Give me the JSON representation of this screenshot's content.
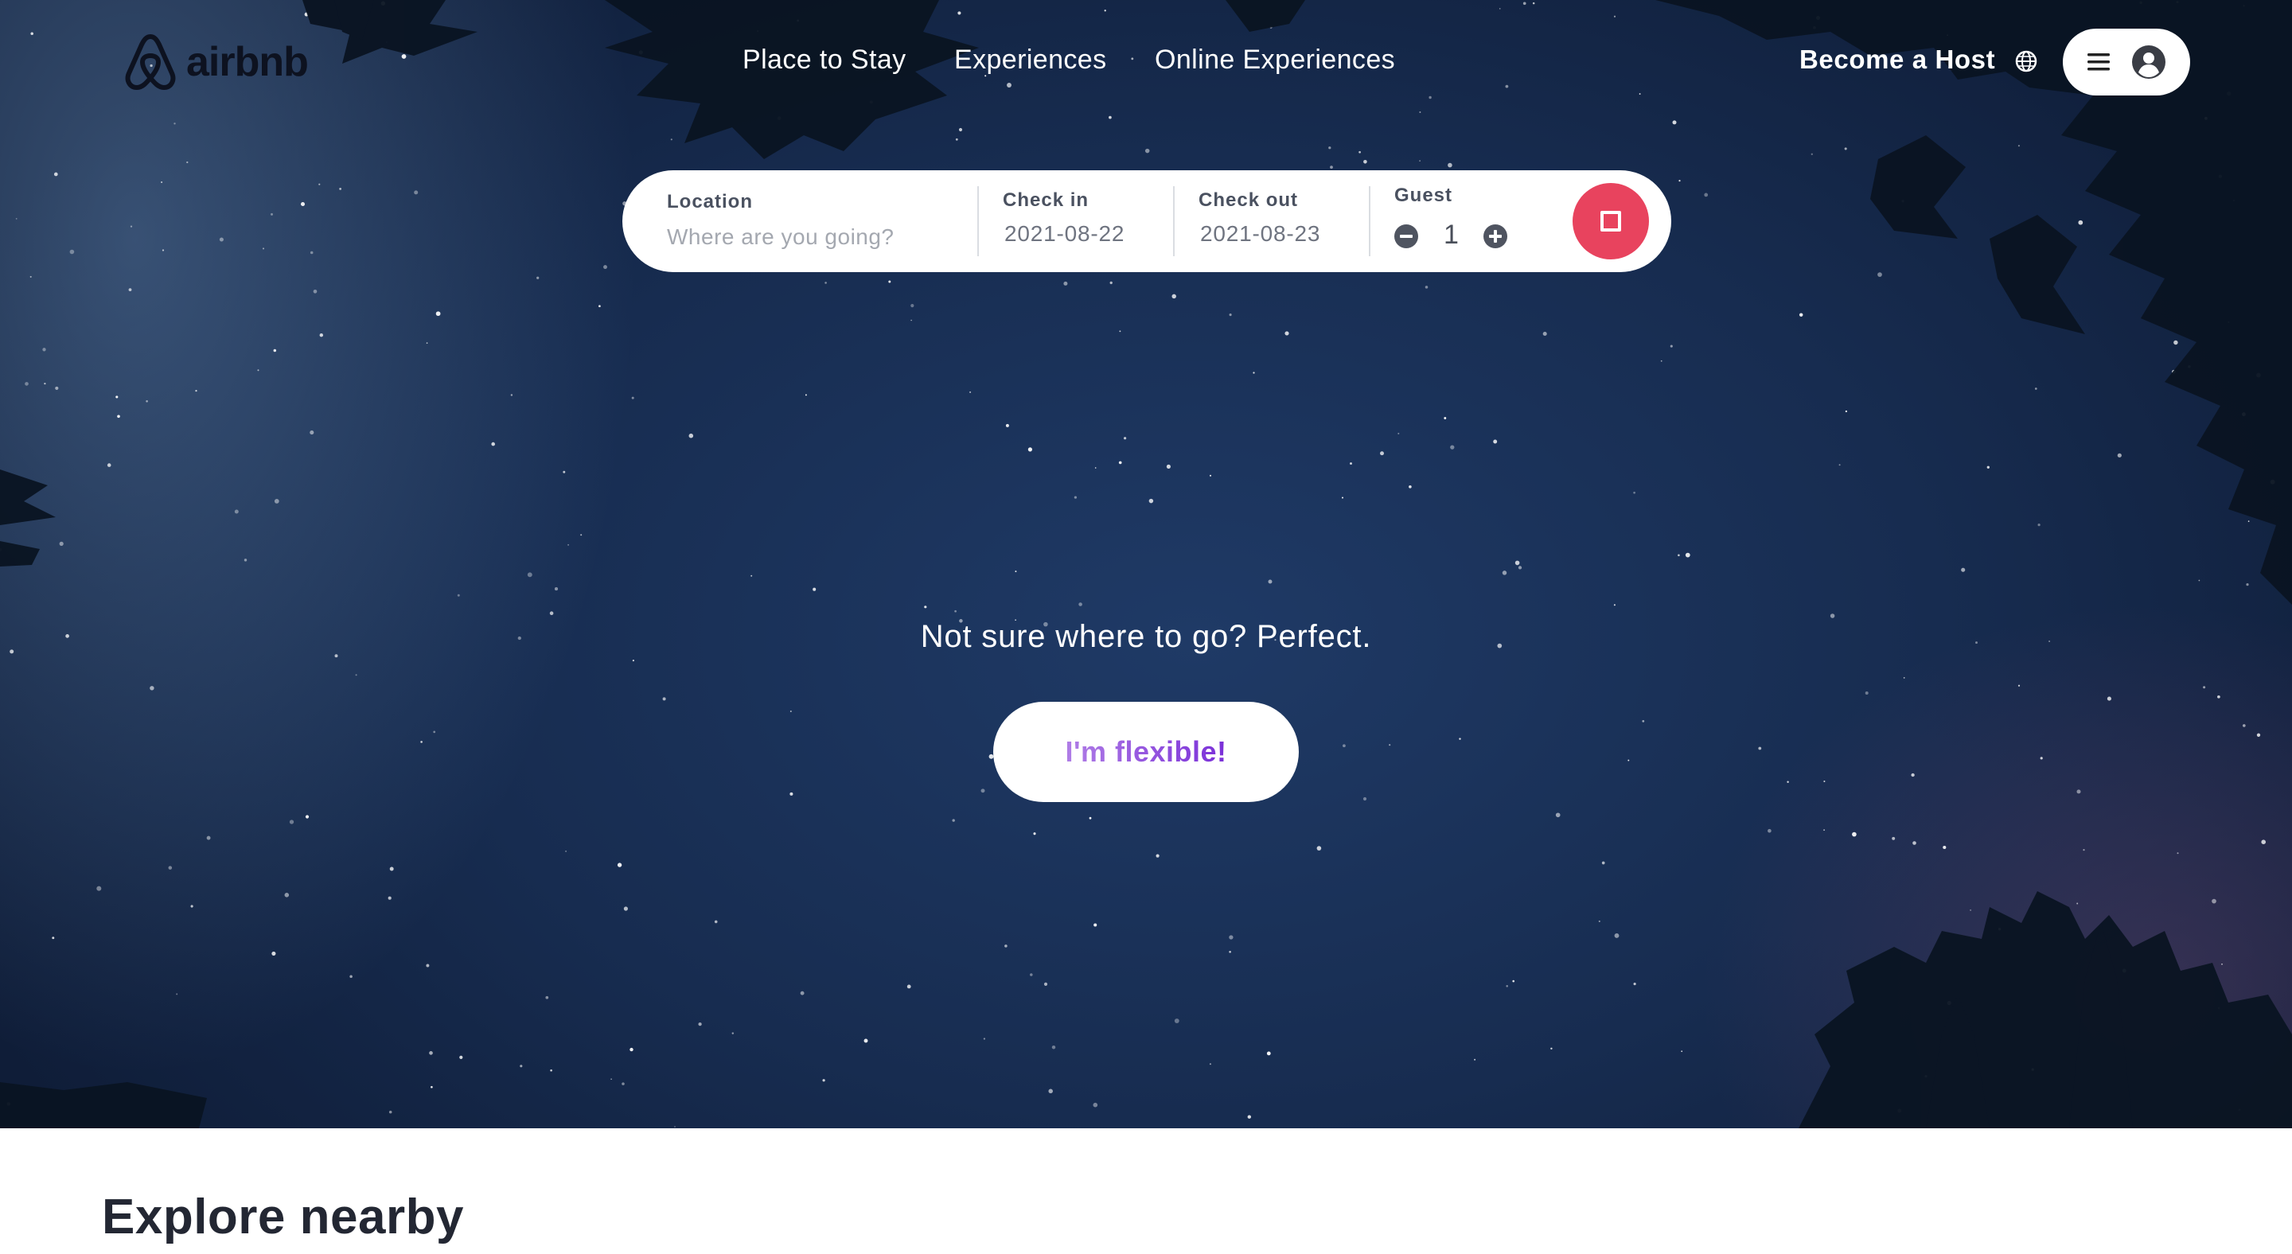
{
  "brand": {
    "name": "airbnb",
    "color": "#0d1220",
    "icon": "airbnb-belo-icon"
  },
  "nav": {
    "links": [
      "Place to Stay",
      "Experiences",
      "Online Experiences"
    ],
    "host_label": "Become a Host",
    "globe_icon": "globe-icon",
    "menu_icon": "hamburger-icon",
    "avatar_icon": "user-avatar-icon"
  },
  "search": {
    "location_label": "Location",
    "location_placeholder": "Where are you going?",
    "checkin_label": "Check in",
    "checkin_value": "2021-08-22",
    "checkout_label": "Check out",
    "checkout_value": "2021-08-23",
    "guest_label": "Guest",
    "guest_count": "1",
    "minus_icon": "minus-circle-icon",
    "plus_icon": "plus-circle-icon",
    "submit_icon": "square-icon",
    "accent": "#e8435e"
  },
  "hero": {
    "tagline": "Not sure where to go? Perfect.",
    "cta": "I'm flexible!",
    "cta_gradient": [
      "#b07ee6",
      "#7a2fd8"
    ]
  },
  "section": {
    "title": "Explore nearby"
  }
}
